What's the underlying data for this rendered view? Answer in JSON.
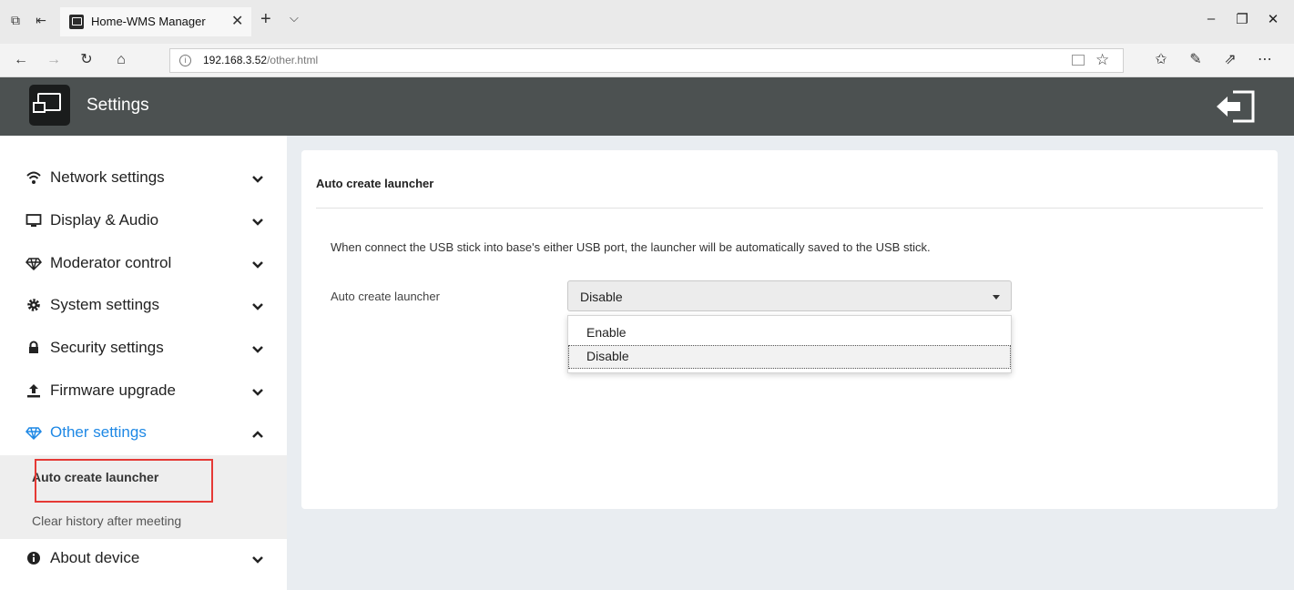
{
  "browser": {
    "tab_title": "Home-WMS Manager",
    "url_host": "192.168.3.52",
    "url_path": "/other.html"
  },
  "header": {
    "title": "Settings",
    "bg_color": "#4c5151"
  },
  "sidebar": {
    "items": [
      {
        "label": "Network settings",
        "icon": "wifi-icon",
        "expanded": false
      },
      {
        "label": "Display & Audio",
        "icon": "monitor-icon",
        "expanded": false
      },
      {
        "label": "Moderator control",
        "icon": "diamond-icon",
        "expanded": false
      },
      {
        "label": "System settings",
        "icon": "gear-icon",
        "expanded": false
      },
      {
        "label": "Security settings",
        "icon": "lock-icon",
        "expanded": false
      },
      {
        "label": "Firmware upgrade",
        "icon": "upload-icon",
        "expanded": false
      },
      {
        "label": "Other settings",
        "icon": "diamond-icon",
        "expanded": true
      },
      {
        "label": "About device",
        "icon": "info-icon",
        "expanded": false
      }
    ],
    "submenu": [
      "Auto create launcher",
      "Clear history after meeting"
    ],
    "active_color": "#1e88e5"
  },
  "main": {
    "card_title": "Auto create launcher",
    "description": "When connect the USB stick into base's either USB port, the launcher will be automatically saved to the USB stick.",
    "field_label": "Auto create launcher",
    "select_value": "Disable",
    "options": [
      "Enable",
      "Disable"
    ]
  }
}
